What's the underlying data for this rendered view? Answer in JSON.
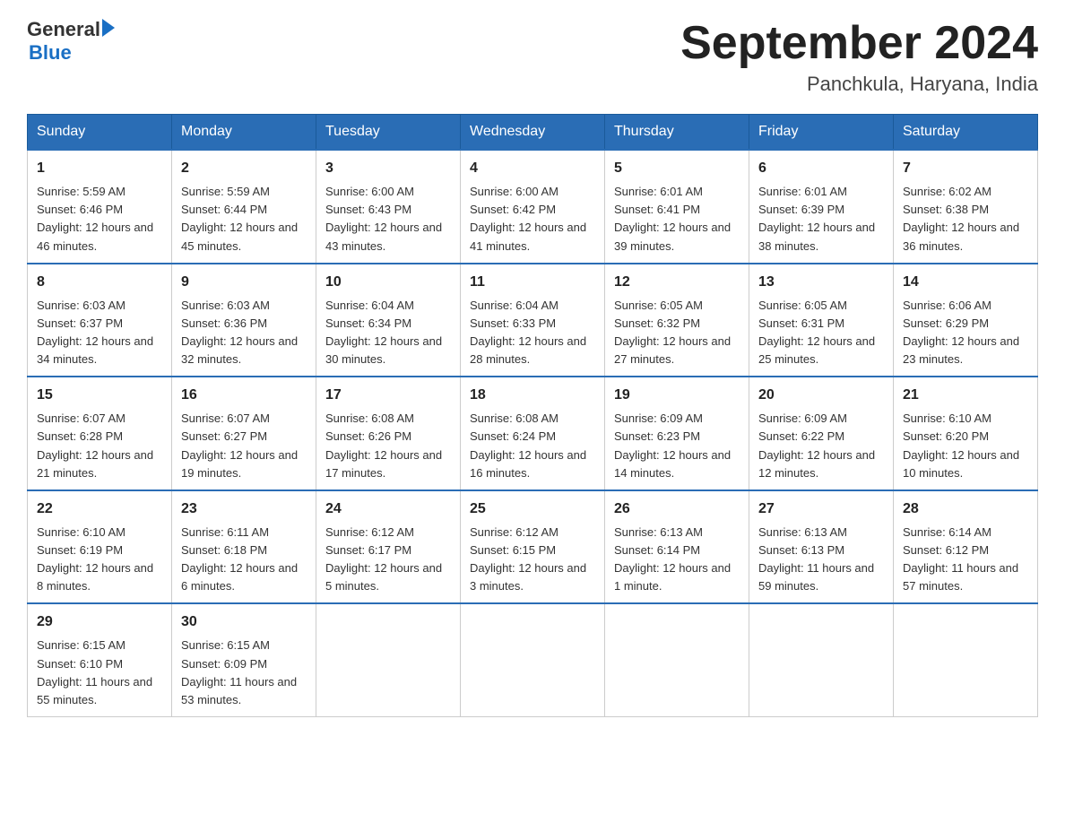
{
  "header": {
    "logo_general": "General",
    "logo_blue": "Blue",
    "title": "September 2024",
    "location": "Panchkula, Haryana, India"
  },
  "days_of_week": [
    "Sunday",
    "Monday",
    "Tuesday",
    "Wednesday",
    "Thursday",
    "Friday",
    "Saturday"
  ],
  "weeks": [
    [
      {
        "day": "1",
        "sunrise": "5:59 AM",
        "sunset": "6:46 PM",
        "daylight": "12 hours and 46 minutes."
      },
      {
        "day": "2",
        "sunrise": "5:59 AM",
        "sunset": "6:44 PM",
        "daylight": "12 hours and 45 minutes."
      },
      {
        "day": "3",
        "sunrise": "6:00 AM",
        "sunset": "6:43 PM",
        "daylight": "12 hours and 43 minutes."
      },
      {
        "day": "4",
        "sunrise": "6:00 AM",
        "sunset": "6:42 PM",
        "daylight": "12 hours and 41 minutes."
      },
      {
        "day": "5",
        "sunrise": "6:01 AM",
        "sunset": "6:41 PM",
        "daylight": "12 hours and 39 minutes."
      },
      {
        "day": "6",
        "sunrise": "6:01 AM",
        "sunset": "6:39 PM",
        "daylight": "12 hours and 38 minutes."
      },
      {
        "day": "7",
        "sunrise": "6:02 AM",
        "sunset": "6:38 PM",
        "daylight": "12 hours and 36 minutes."
      }
    ],
    [
      {
        "day": "8",
        "sunrise": "6:03 AM",
        "sunset": "6:37 PM",
        "daylight": "12 hours and 34 minutes."
      },
      {
        "day": "9",
        "sunrise": "6:03 AM",
        "sunset": "6:36 PM",
        "daylight": "12 hours and 32 minutes."
      },
      {
        "day": "10",
        "sunrise": "6:04 AM",
        "sunset": "6:34 PM",
        "daylight": "12 hours and 30 minutes."
      },
      {
        "day": "11",
        "sunrise": "6:04 AM",
        "sunset": "6:33 PM",
        "daylight": "12 hours and 28 minutes."
      },
      {
        "day": "12",
        "sunrise": "6:05 AM",
        "sunset": "6:32 PM",
        "daylight": "12 hours and 27 minutes."
      },
      {
        "day": "13",
        "sunrise": "6:05 AM",
        "sunset": "6:31 PM",
        "daylight": "12 hours and 25 minutes."
      },
      {
        "day": "14",
        "sunrise": "6:06 AM",
        "sunset": "6:29 PM",
        "daylight": "12 hours and 23 minutes."
      }
    ],
    [
      {
        "day": "15",
        "sunrise": "6:07 AM",
        "sunset": "6:28 PM",
        "daylight": "12 hours and 21 minutes."
      },
      {
        "day": "16",
        "sunrise": "6:07 AM",
        "sunset": "6:27 PM",
        "daylight": "12 hours and 19 minutes."
      },
      {
        "day": "17",
        "sunrise": "6:08 AM",
        "sunset": "6:26 PM",
        "daylight": "12 hours and 17 minutes."
      },
      {
        "day": "18",
        "sunrise": "6:08 AM",
        "sunset": "6:24 PM",
        "daylight": "12 hours and 16 minutes."
      },
      {
        "day": "19",
        "sunrise": "6:09 AM",
        "sunset": "6:23 PM",
        "daylight": "12 hours and 14 minutes."
      },
      {
        "day": "20",
        "sunrise": "6:09 AM",
        "sunset": "6:22 PM",
        "daylight": "12 hours and 12 minutes."
      },
      {
        "day": "21",
        "sunrise": "6:10 AM",
        "sunset": "6:20 PM",
        "daylight": "12 hours and 10 minutes."
      }
    ],
    [
      {
        "day": "22",
        "sunrise": "6:10 AM",
        "sunset": "6:19 PM",
        "daylight": "12 hours and 8 minutes."
      },
      {
        "day": "23",
        "sunrise": "6:11 AM",
        "sunset": "6:18 PM",
        "daylight": "12 hours and 6 minutes."
      },
      {
        "day": "24",
        "sunrise": "6:12 AM",
        "sunset": "6:17 PM",
        "daylight": "12 hours and 5 minutes."
      },
      {
        "day": "25",
        "sunrise": "6:12 AM",
        "sunset": "6:15 PM",
        "daylight": "12 hours and 3 minutes."
      },
      {
        "day": "26",
        "sunrise": "6:13 AM",
        "sunset": "6:14 PM",
        "daylight": "12 hours and 1 minute."
      },
      {
        "day": "27",
        "sunrise": "6:13 AM",
        "sunset": "6:13 PM",
        "daylight": "11 hours and 59 minutes."
      },
      {
        "day": "28",
        "sunrise": "6:14 AM",
        "sunset": "6:12 PM",
        "daylight": "11 hours and 57 minutes."
      }
    ],
    [
      {
        "day": "29",
        "sunrise": "6:15 AM",
        "sunset": "6:10 PM",
        "daylight": "11 hours and 55 minutes."
      },
      {
        "day": "30",
        "sunrise": "6:15 AM",
        "sunset": "6:09 PM",
        "daylight": "11 hours and 53 minutes."
      },
      null,
      null,
      null,
      null,
      null
    ]
  ]
}
